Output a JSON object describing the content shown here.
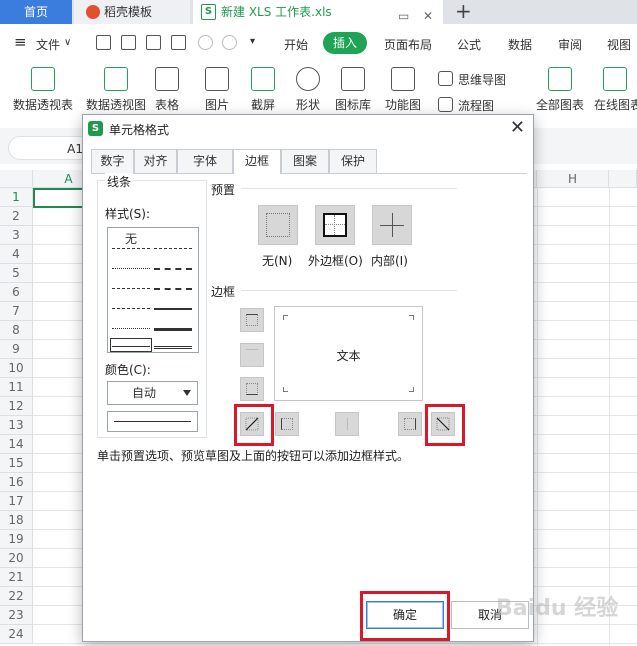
{
  "tabs": {
    "home": "首页",
    "template": "稻壳模板",
    "file": "新建 XLS 工作表.xls",
    "file_badge": "S"
  },
  "menu": {
    "file": "文件",
    "items": [
      "开始",
      "插入",
      "页面布局",
      "公式",
      "数据",
      "审阅",
      "视图"
    ],
    "active": "插入"
  },
  "ribbon": {
    "pivot_table": "数据透视表",
    "pivot_chart": "数据透视图",
    "table": "表格",
    "picture": "图片",
    "screenshot": "截屏",
    "shape": "形状",
    "icon_lib": "图标库",
    "function_chart": "功能图",
    "mind_map": "思维导图",
    "flowchart": "流程图",
    "all_charts": "全部图表",
    "online_chart": "在线图表"
  },
  "formula_bar": {
    "cell_ref": "A1"
  },
  "sheet": {
    "columns": [
      "A",
      "H"
    ],
    "rows": [
      "1",
      "2",
      "3",
      "4",
      "5",
      "6",
      "7",
      "8",
      "9",
      "10",
      "11",
      "12",
      "13",
      "14",
      "15",
      "16",
      "17",
      "18",
      "19",
      "20",
      "21",
      "22",
      "23",
      "24"
    ]
  },
  "dialog": {
    "title": "单元格格式",
    "logo": "S",
    "tabs": [
      "数字",
      "对齐",
      "字体",
      "边框",
      "图案",
      "保护"
    ],
    "active_tab": "边框",
    "line_group": {
      "title": "线条",
      "style_label": "样式(S):",
      "none_label": "无",
      "color_label": "颜色(C):",
      "color_value": "自动"
    },
    "presets": {
      "title": "预置",
      "none": "无(N)",
      "outline": "外边框(O)",
      "inside": "内部(I)"
    },
    "border": {
      "title": "边框",
      "preview_text": "文本"
    },
    "hint": "单击预置选项、预览草图及上面的按钮可以添加边框样式。",
    "ok": "确定",
    "cancel": "取消"
  },
  "colors": {
    "accent_green": "#1fa354",
    "tab_blue": "#3b7ddd",
    "highlight_red": "#d9192a"
  },
  "watermark": "Baidu 经验"
}
